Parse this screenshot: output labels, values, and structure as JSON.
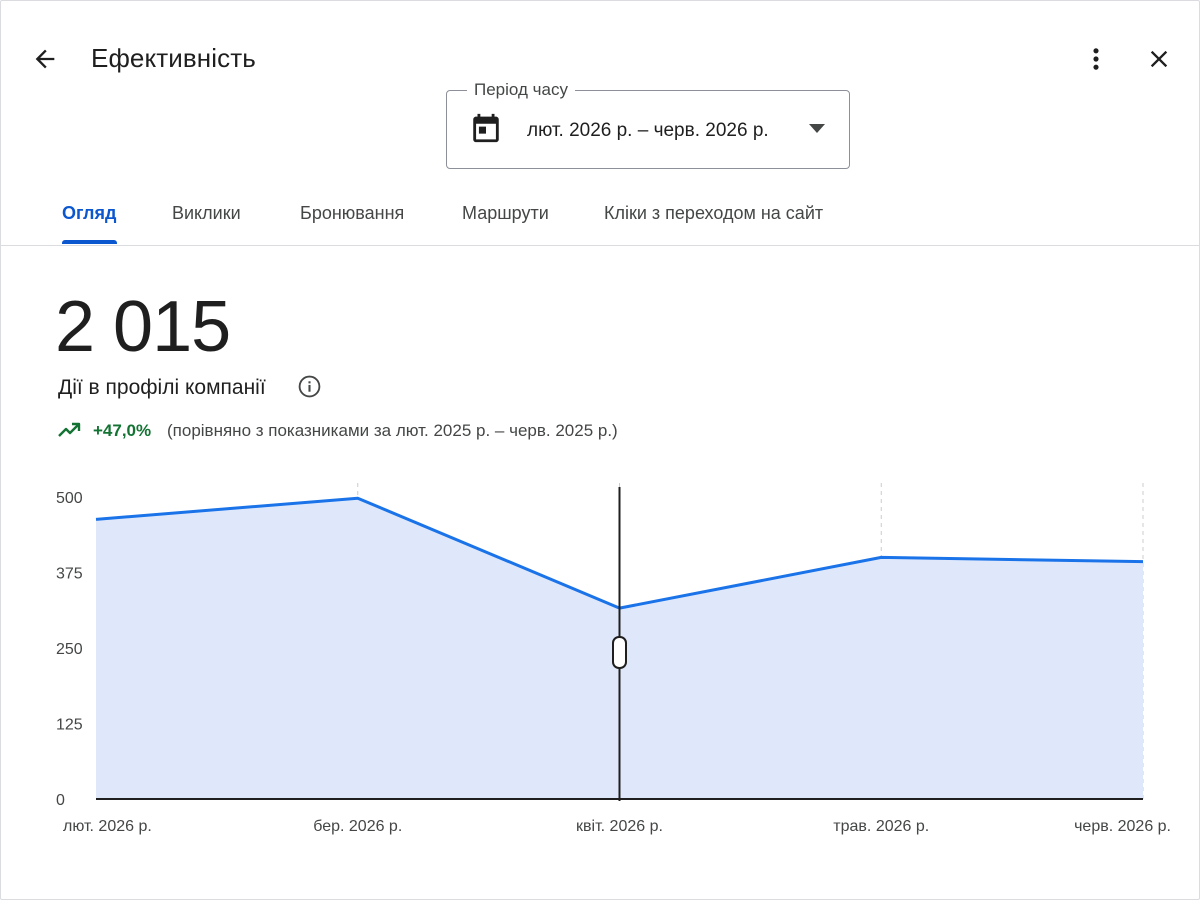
{
  "header": {
    "title": "Ефективність",
    "back_icon": "arrow-back-icon",
    "more_icon": "more-vert-icon",
    "close_icon": "close-icon"
  },
  "period": {
    "label": "Період часу",
    "value": "лют. 2026 р. – черв. 2026 р.",
    "icon": "calendar-icon"
  },
  "tabs": [
    {
      "label": "Огляд",
      "active": true
    },
    {
      "label": "Виклики",
      "active": false
    },
    {
      "label": "Бронювання",
      "active": false
    },
    {
      "label": "Маршрути",
      "active": false
    },
    {
      "label": "Кліки з переходом на сайт",
      "active": false
    }
  ],
  "summary": {
    "total": "2 015",
    "metric_label": "Дії в профілі компанії",
    "delta": "+47,0%",
    "comparison": "(порівняно з показниками за лют. 2025 р. – черв. 2025 р.)",
    "delta_color": "#137333"
  },
  "colors": {
    "accent": "#0b57d0",
    "line": "#1a73e8",
    "area": "#dfe8fb"
  },
  "chart_data": {
    "type": "area",
    "categories": [
      "лют. 2026 р.",
      "бер. 2026 р.",
      "квіт. 2026 р.",
      "трав. 2026 р.",
      "черв. 2026 р."
    ],
    "values": [
      463,
      498,
      316,
      400,
      393
    ],
    "ylim": [
      0,
      500
    ],
    "yticks": [
      "0",
      "125",
      "250",
      "375",
      "500"
    ],
    "grid": "vertical dashed",
    "cursor_category": "квіт. 2026 р."
  }
}
